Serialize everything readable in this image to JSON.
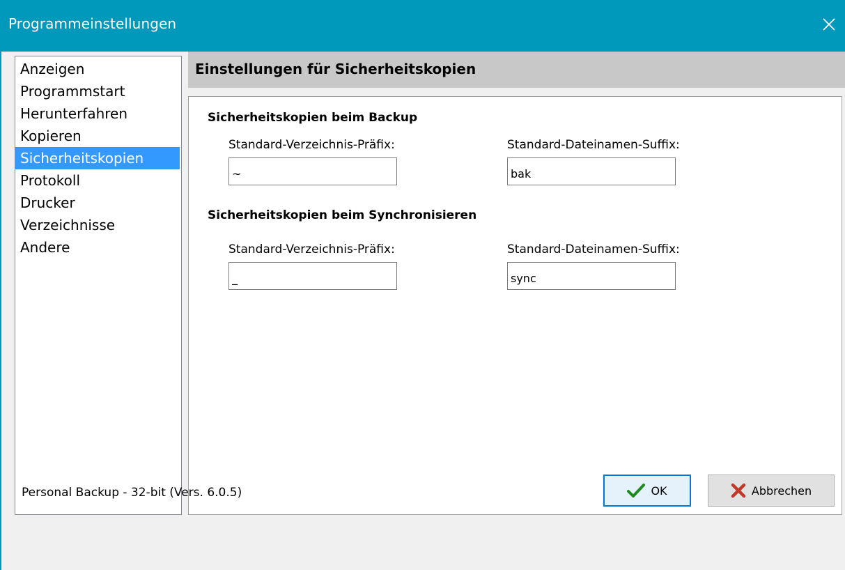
{
  "window": {
    "title": "Programmeinstellungen"
  },
  "sidebar": {
    "items": [
      {
        "label": "Anzeigen"
      },
      {
        "label": "Programmstart"
      },
      {
        "label": "Herunterfahren"
      },
      {
        "label": "Kopieren"
      },
      {
        "label": "Sicherheitskopien"
      },
      {
        "label": "Protokoll"
      },
      {
        "label": "Drucker"
      },
      {
        "label": "Verzeichnisse"
      },
      {
        "label": "Andere"
      }
    ],
    "selected": "Sicherheitskopien"
  },
  "page": {
    "header": "Einstellungen für Sicherheitskopien",
    "backup": {
      "group_title": "Sicherheitskopien beim Backup",
      "prefix_label": "Standard-Verzeichnis-Präfix:",
      "prefix_value": "~",
      "suffix_label": "Standard-Dateinamen-Suffix:",
      "suffix_value": "bak"
    },
    "sync": {
      "group_title": "Sicherheitskopien beim Synchronisieren",
      "prefix_label": "Standard-Verzeichnis-Präfix:",
      "prefix_value": "_",
      "suffix_label": "Standard-Dateinamen-Suffix:",
      "suffix_value": "sync"
    }
  },
  "footer": {
    "version_text": "Personal Backup - 32-bit (Vers. 6.0.5)",
    "ok_label": "OK",
    "cancel_label": "Abbrechen"
  },
  "colors": {
    "titlebar": "#0099bc",
    "selection": "#3399ff",
    "header_band": "#c8c8c8",
    "ok_check": "#1e8a1e",
    "cancel_x": "#c0392b"
  },
  "icons": {
    "close": "close-icon",
    "ok": "checkmark-icon",
    "cancel": "red-x-icon"
  }
}
